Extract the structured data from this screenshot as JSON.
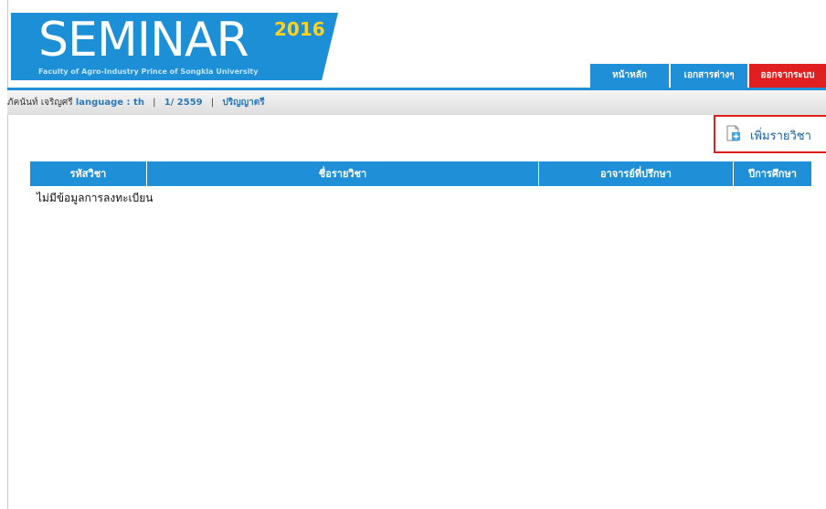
{
  "header": {
    "title": "SEMINAR",
    "year": "2016",
    "subtitle": "Faculty of Agro-Industry  Prince of Songkla University"
  },
  "nav": {
    "home": "หน้าหลัก",
    "documents": "เอกสารต่างๆ",
    "logout": "ออกจากระบบ"
  },
  "info": {
    "user": "ภัคนันท์ เจริญศรี",
    "language": "language : th",
    "term": "1/ 2559",
    "degree": "ปริญญาตรี"
  },
  "actions": {
    "add_course": "เพิ่มรายวิชา"
  },
  "table": {
    "columns": [
      "รหัสวิชา",
      "ชื่อรายวิชา",
      "อาจารย์ที่ปรึกษา",
      "ปีการศึกษา"
    ],
    "empty_message": "ไม่มีข้อมูลการลงทะเบียน"
  },
  "colors": {
    "brand_blue": "#1f8fd8",
    "year_yellow": "#ffd21f",
    "logout_red": "#e02020",
    "highlight_red": "#e21d1d"
  },
  "icons": {
    "add_course": "add-document-icon"
  }
}
